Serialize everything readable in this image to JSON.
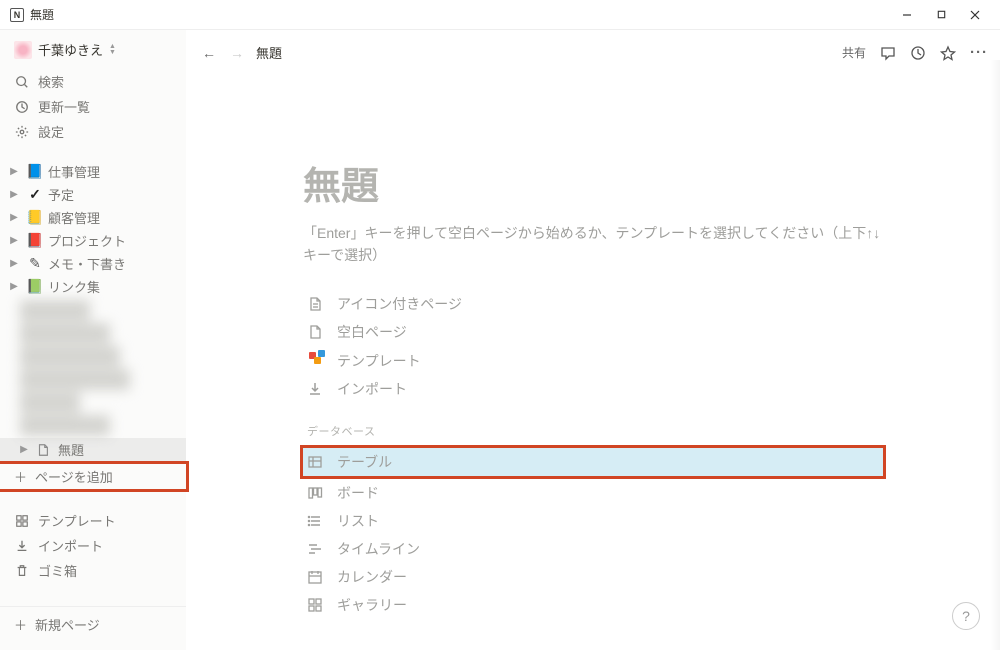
{
  "window_title": "無題",
  "workspace": {
    "user_name": "千葉ゆきえ"
  },
  "sidebar": {
    "search": "検索",
    "updates": "更新一覧",
    "settings": "設定",
    "pages": [
      {
        "icon": "📘",
        "label": "仕事管理"
      },
      {
        "icon": "✓",
        "label": "予定"
      },
      {
        "icon": "📒",
        "label": "顧客管理"
      },
      {
        "icon": "📕",
        "label": "プロジェクト"
      },
      {
        "icon": "✎",
        "label": "メモ・下書き"
      },
      {
        "icon": "📗",
        "label": "リンク集"
      }
    ],
    "current_page": {
      "icon": "🗎",
      "label": "無題"
    },
    "add_page": "ページを追加",
    "footer": {
      "templates": "テンプレート",
      "import": "インポート",
      "trash": "ゴミ箱"
    },
    "new_page": "新規ページ"
  },
  "topbar": {
    "breadcrumb": "無題",
    "share": "共有"
  },
  "page": {
    "title": "無題",
    "help_text": "「Enter」キーを押して空白ページから始めるか、テンプレートを選択してください（上下↑↓キーで選択）",
    "template_options": [
      {
        "label": "アイコン付きページ"
      },
      {
        "label": "空白ページ"
      },
      {
        "label": "テンプレート"
      },
      {
        "label": "インポート"
      }
    ],
    "database_label": "データベース",
    "database_options": [
      {
        "label": "テーブル"
      },
      {
        "label": "ボード"
      },
      {
        "label": "リスト"
      },
      {
        "label": "タイムライン"
      },
      {
        "label": "カレンダー"
      },
      {
        "label": "ギャラリー"
      }
    ]
  }
}
